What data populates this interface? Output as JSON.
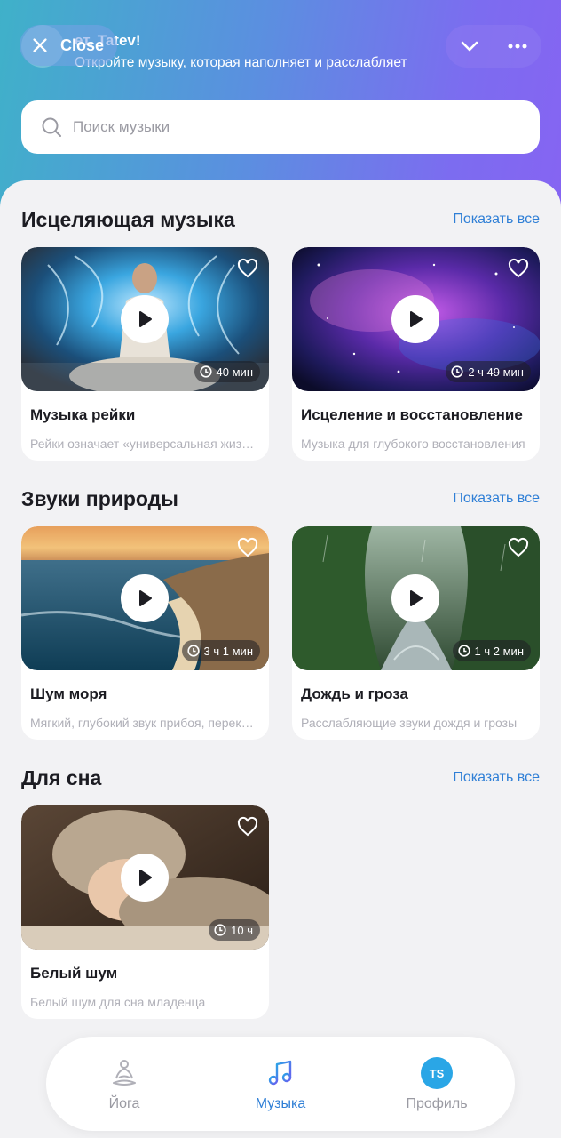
{
  "header": {
    "greeting": "ет, Tatev!",
    "subtitle": "Откройте музыку, которая наполняет и расслабляет",
    "close_label": "Close"
  },
  "search": {
    "placeholder": "Поиск музыки"
  },
  "sections": [
    {
      "title": "Исцеляющая музыка",
      "show_all": "Показать все",
      "cards": [
        {
          "title": "Музыка рейки",
          "desc": "Рейки означает «универсальная жизненная энергия»",
          "duration": "40 мин"
        },
        {
          "title": "Исцеление и восстановление",
          "desc": "Музыка для глубокого восстановления",
          "duration": "2 ч 49 мин"
        }
      ]
    },
    {
      "title": "Звуки природы",
      "show_all": "Показать все",
      "cards": [
        {
          "title": "Шум моря",
          "desc": "Мягкий, глубокий звук прибоя, перекатывающийся",
          "duration": "3 ч 1 мин"
        },
        {
          "title": "Дождь и гроза",
          "desc": "Расслабляющие звуки дождя и грозы",
          "duration": "1 ч 2 мин"
        }
      ]
    },
    {
      "title": "Для сна",
      "show_all": "Показать все",
      "cards": [
        {
          "title": "Белый шум",
          "desc": "Белый шум для сна младенца",
          "duration": "10 ч"
        }
      ]
    }
  ],
  "tabbar": {
    "items": [
      {
        "label": "Йога",
        "icon": "yoga-icon"
      },
      {
        "label": "Музыка",
        "icon": "music-note-icon",
        "active": true
      },
      {
        "label": "Профиль",
        "icon": "profile-avatar",
        "initials": "TS"
      }
    ]
  },
  "colors": {
    "accent": "#2f7fd6",
    "gradient_start": "#3fb1c9",
    "gradient_end": "#8664f2",
    "badge": "#2aa6e6"
  }
}
